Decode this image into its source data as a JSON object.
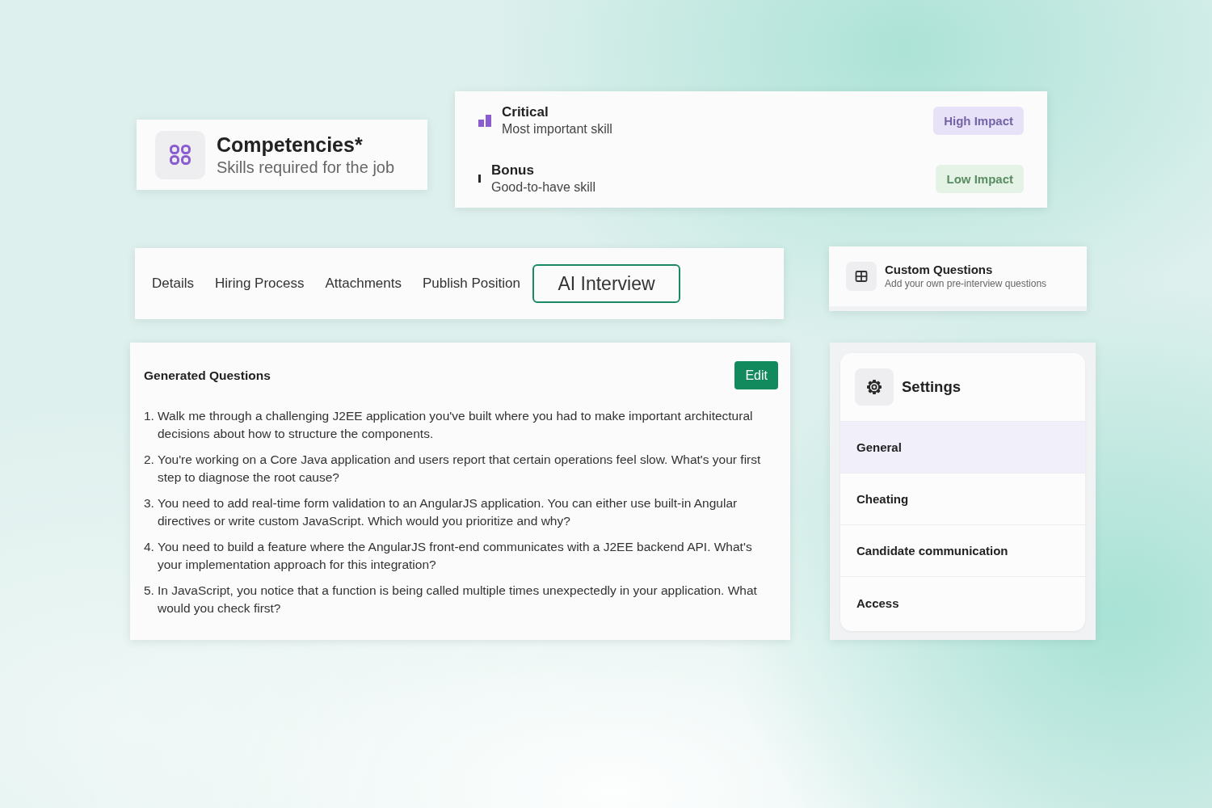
{
  "competencies": {
    "title": "Competencies*",
    "subtitle": "Skills required for the job"
  },
  "levels": [
    {
      "kind": "critical",
      "name": "Critical",
      "description": "Most important skill",
      "badge": "High Impact"
    },
    {
      "kind": "bonus",
      "name": "Bonus",
      "description": "Good-to-have skill",
      "badge": "Low Impact"
    }
  ],
  "tabs": [
    {
      "label": "Details",
      "selected": false
    },
    {
      "label": "Hiring Process",
      "selected": false
    },
    {
      "label": "Attachments",
      "selected": false
    },
    {
      "label": "Publish Position",
      "selected": false
    },
    {
      "label": "AI Interview",
      "selected": true
    }
  ],
  "custom_questions": {
    "title": "Custom Questions",
    "subtitle": "Add your own pre-interview questions"
  },
  "generated_questions": {
    "title": "Generated Questions",
    "edit_button": "Edit",
    "questions": [
      {
        "number": "1.",
        "text": "Walk me through a challenging J2EE application you've built where you had to make important architectural decisions about how to structure the components."
      },
      {
        "number": "2.",
        "text": "You're working on a Core Java application and users report that certain operations feel slow. What's your first step to diagnose the root cause?"
      },
      {
        "number": "3.",
        "text": "You need to add real-time form validation to an AngularJS application. You can either use built-in Angular directives or write custom JavaScript. Which would you prioritize and why?"
      },
      {
        "number": "4.",
        "text": "You need to build a feature where the AngularJS front-end communicates with a J2EE backend API. What's your implementation approach for this integration?"
      },
      {
        "number": "5.",
        "text": "In JavaScript, you notice that a function is being called multiple times unexpectedly in your application. What would you check first?"
      }
    ]
  },
  "settings": {
    "title": "Settings",
    "items": [
      {
        "label": "General",
        "selected": true
      },
      {
        "label": "Cheating",
        "selected": false
      },
      {
        "label": "Candidate communication",
        "selected": false
      },
      {
        "label": "Access",
        "selected": false
      }
    ]
  }
}
